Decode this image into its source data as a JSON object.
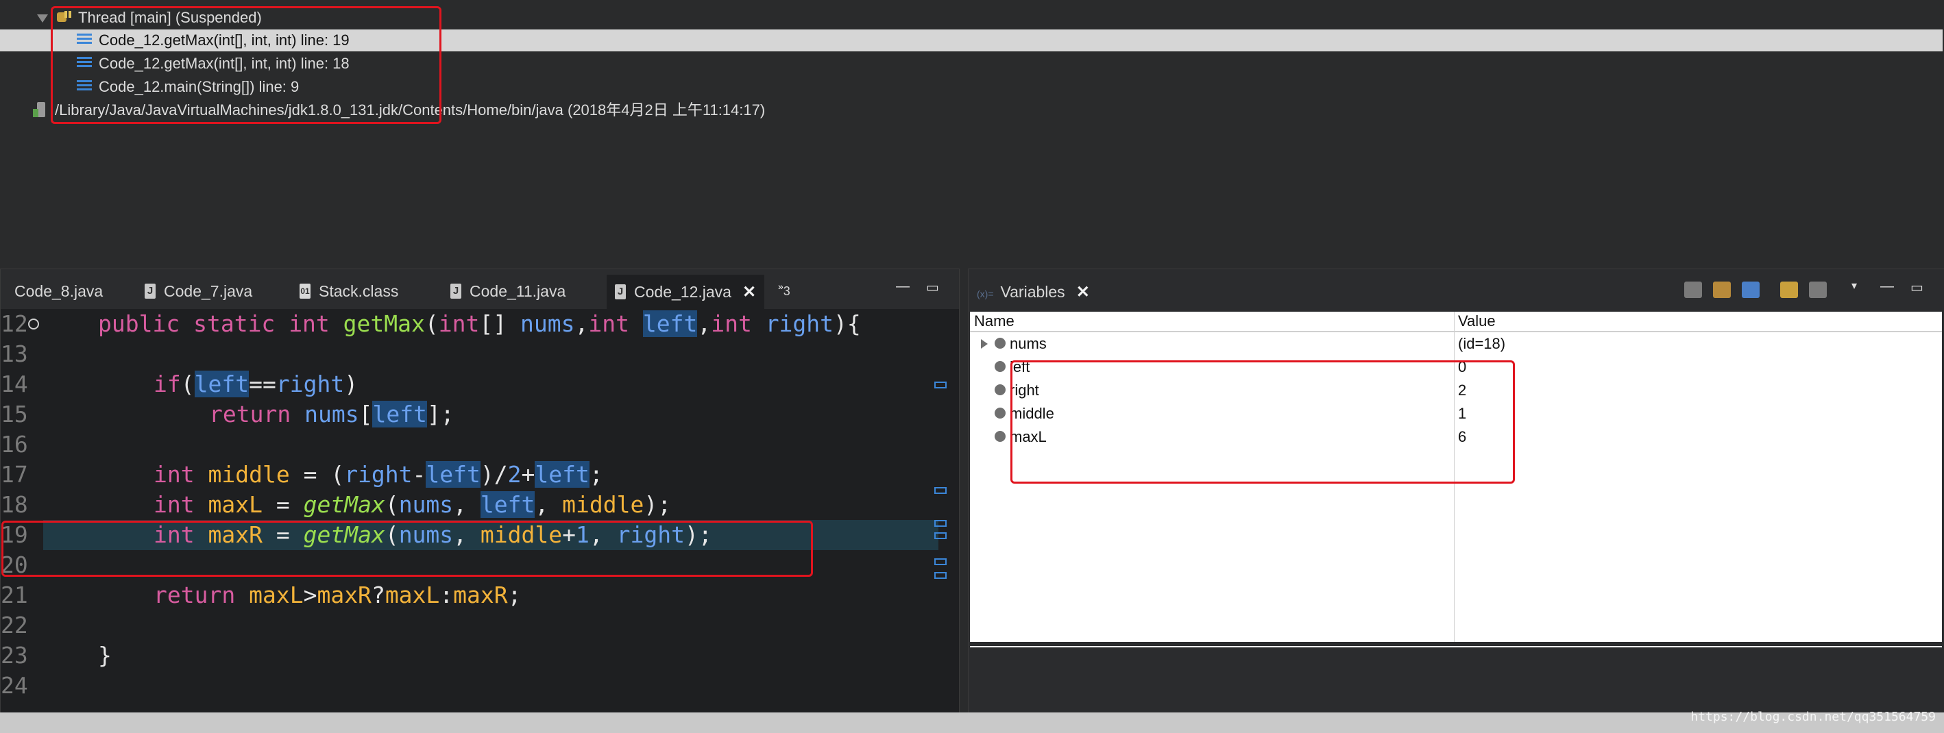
{
  "debug": {
    "thread_label": "Thread [main] (Suspended)",
    "frames": [
      {
        "label": "Code_12.getMax(int[], int, int) line: 19",
        "selected": true
      },
      {
        "label": "Code_12.getMax(int[], int, int) line: 18",
        "selected": false
      },
      {
        "label": "Code_12.main(String[]) line: 9",
        "selected": false
      }
    ],
    "process_label": "/Library/Java/JavaVirtualMachines/jdk1.8.0_131.jdk/Contents/Home/bin/java (2018年4月2日 上午11:14:17)"
  },
  "editor": {
    "tabs": [
      {
        "label": "Code_8.java",
        "icon": "java-file-icon"
      },
      {
        "label": "Code_7.java",
        "icon": "java-file-icon"
      },
      {
        "label": "Stack.class",
        "icon": "class-file-icon"
      },
      {
        "label": "Code_11.java",
        "icon": "java-file-icon"
      },
      {
        "label": "Code_12.java",
        "icon": "java-file-icon",
        "active": true
      }
    ],
    "overflow_label": "3",
    "line_numbers": [
      "12",
      "13",
      "14",
      "15",
      "16",
      "17",
      "18",
      "19",
      "20",
      "21",
      "22",
      "23",
      "24"
    ],
    "current_line": "19"
  },
  "variables": {
    "tab_label": "Variables",
    "col_name": "Name",
    "col_value": "Value",
    "rows": [
      {
        "name": "nums",
        "value": "(id=18)",
        "expandable": true
      },
      {
        "name": "left",
        "value": "0",
        "expandable": false
      },
      {
        "name": "right",
        "value": "2",
        "expandable": false
      },
      {
        "name": "middle",
        "value": "1",
        "expandable": false
      },
      {
        "name": "maxL",
        "value": "6",
        "expandable": false
      }
    ]
  },
  "watermark": "https://blog.csdn.net/qq351564759",
  "colors": {
    "highlight_box": "#e0141e",
    "keyword": "#d85ca0",
    "method": "#9bde4f",
    "param": "#6aa0ee",
    "local": "#f3b33a",
    "current_line_bg": "#203a45",
    "occurrence_bg": "#1f4a78"
  }
}
